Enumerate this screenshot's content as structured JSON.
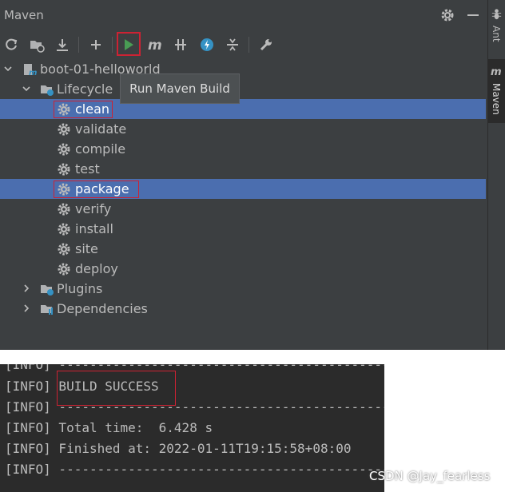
{
  "window": {
    "title": "Maven"
  },
  "toolbar": {
    "buttons": [
      "reload-icon",
      "add-folder-icon",
      "download-icon",
      "plus-icon",
      "run-icon",
      "maven-m-icon",
      "toggle-offline-icon",
      "skip-tests-icon",
      "collapse-icon",
      "wrench-icon"
    ],
    "run_color": "#499c54"
  },
  "tooltip": {
    "text": "Run Maven Build"
  },
  "tree": {
    "project": "boot-01-helloworld",
    "lifecycle_label": "Lifecycle",
    "phases": [
      "clean",
      "validate",
      "compile",
      "test",
      "package",
      "verify",
      "install",
      "site",
      "deploy"
    ],
    "plugins_label": "Plugins",
    "dependencies_label": "Dependencies",
    "selected": [
      "clean",
      "package"
    ]
  },
  "side_tabs": {
    "ant": "Ant",
    "maven": "Maven"
  },
  "console": {
    "lines": [
      "[INFO] ------------------------------------------------------------------------",
      "[INFO] BUILD SUCCESS",
      "[INFO] ------------------------------------------------------------------------",
      "[INFO] Total time:  6.428 s",
      "[INFO] Finished at: 2022-01-11T19:15:58+08:00",
      "[INFO] ------------------------------------------------------------------------"
    ]
  },
  "watermark": "CSDN @Jay_fearless",
  "colors": {
    "panel_bg": "#3c3f41",
    "selection": "#4b6eaf",
    "highlight": "#cc2233",
    "console_bg": "#2b2b2b"
  }
}
